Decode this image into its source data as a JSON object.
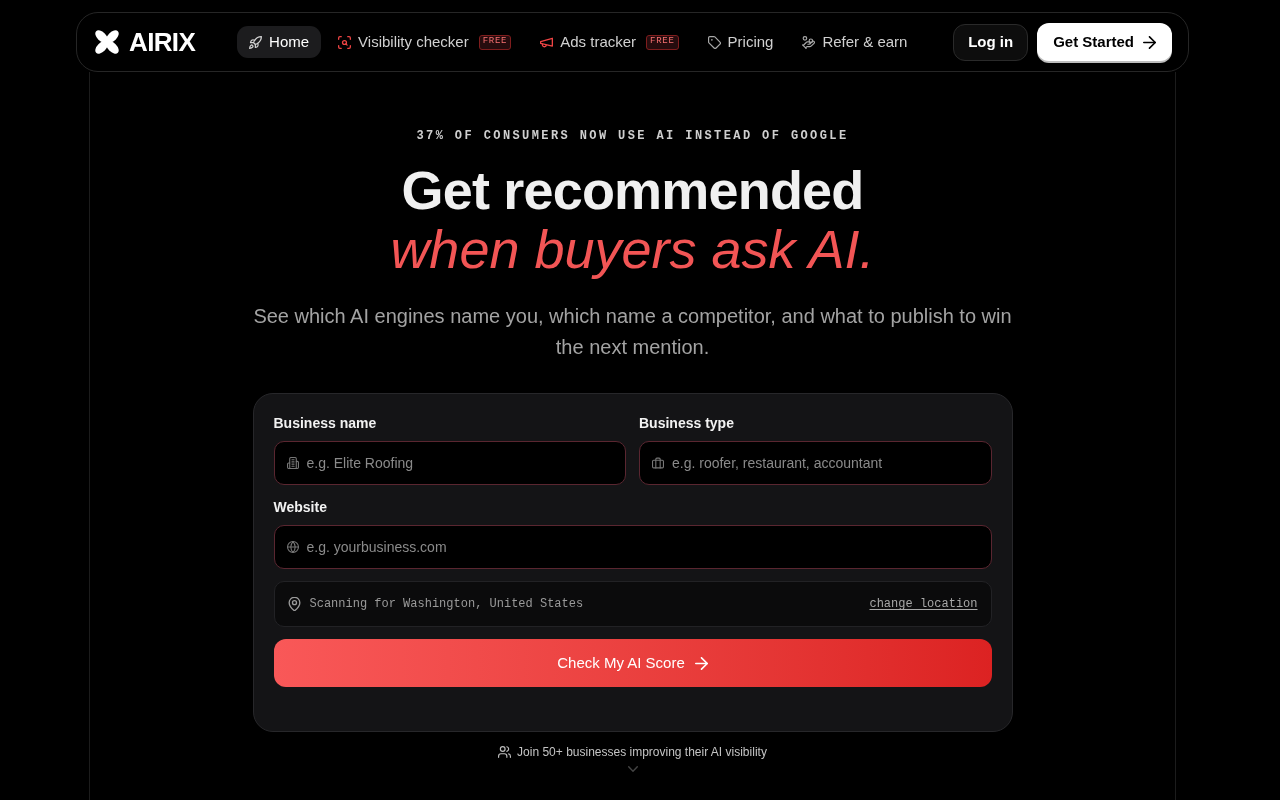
{
  "logo": {
    "text": "AIRIX"
  },
  "nav": {
    "items": [
      {
        "label": "Home",
        "selected": true
      },
      {
        "label": "Visibility checker",
        "selected": false,
        "badge": "FREE"
      },
      {
        "label": "Ads tracker",
        "selected": false,
        "badge": "FREE"
      },
      {
        "label": "Pricing",
        "selected": false
      },
      {
        "label": "Refer & earn",
        "selected": false
      }
    ],
    "buttons": [
      {
        "label": "Log in",
        "kind": "secondary"
      },
      {
        "label": "Get Started",
        "kind": "primary"
      }
    ]
  },
  "hero": {
    "eyebrow": "37% OF CONSUMERS NOW USE AI INSTEAD OF GOOGLE",
    "title": "Get recommended",
    "title_accent": "when buyers ask AI.",
    "subtitle": "See which AI engines name you, which name a competitor, and what to publish to win the next mention."
  },
  "form": {
    "rows": [
      [
        {
          "label": "Business name",
          "placeholder": "e.g. Elite Roofing"
        },
        {
          "label": "Business type",
          "placeholder": "e.g. roofer, restaurant, accountant"
        }
      ],
      [
        {
          "label": "Website",
          "placeholder": "e.g. yourbusiness.com"
        }
      ]
    ],
    "location": {
      "text": "Scanning for Washington, United States",
      "link": "change location"
    },
    "submit": "Check My AI Score"
  },
  "social_proof": "Join 50+ businesses improving their AI visibility"
}
